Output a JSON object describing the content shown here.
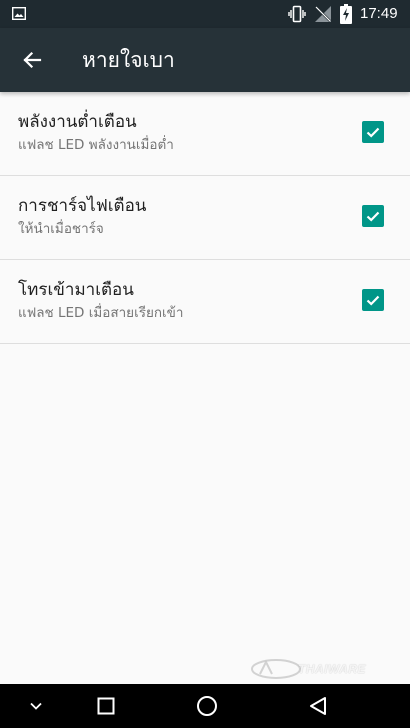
{
  "status_bar": {
    "time": "17:49",
    "icons": [
      "gallery-icon",
      "vibrate-icon",
      "no-signal-icon",
      "battery-charging-icon"
    ]
  },
  "app_bar": {
    "title": "หายใจเบา",
    "back_icon": "arrow-left-icon"
  },
  "settings": [
    {
      "title": "พลังงานต่ำเตือน",
      "summary": "แฟลช LED พลังงานเมื่อต่ำ",
      "checked": true
    },
    {
      "title": "การชาร์จไฟเตือน",
      "summary": "ให้นำเมื่อชาร์จ",
      "checked": true
    },
    {
      "title": "โทรเข้ามาเตือน",
      "summary": "แฟลช LED เมื่อสายเรียกเข้า",
      "checked": true
    }
  ],
  "nav_bar": {
    "buttons": [
      "collapse-icon",
      "recents-icon",
      "home-icon",
      "back-icon"
    ]
  },
  "watermark": {
    "text": "THAIWARE"
  },
  "colors": {
    "status_bar": "#1f2a30",
    "app_bar": "#263238",
    "accent": "#009688",
    "background": "#fafafa",
    "nav_bar": "#000000"
  }
}
